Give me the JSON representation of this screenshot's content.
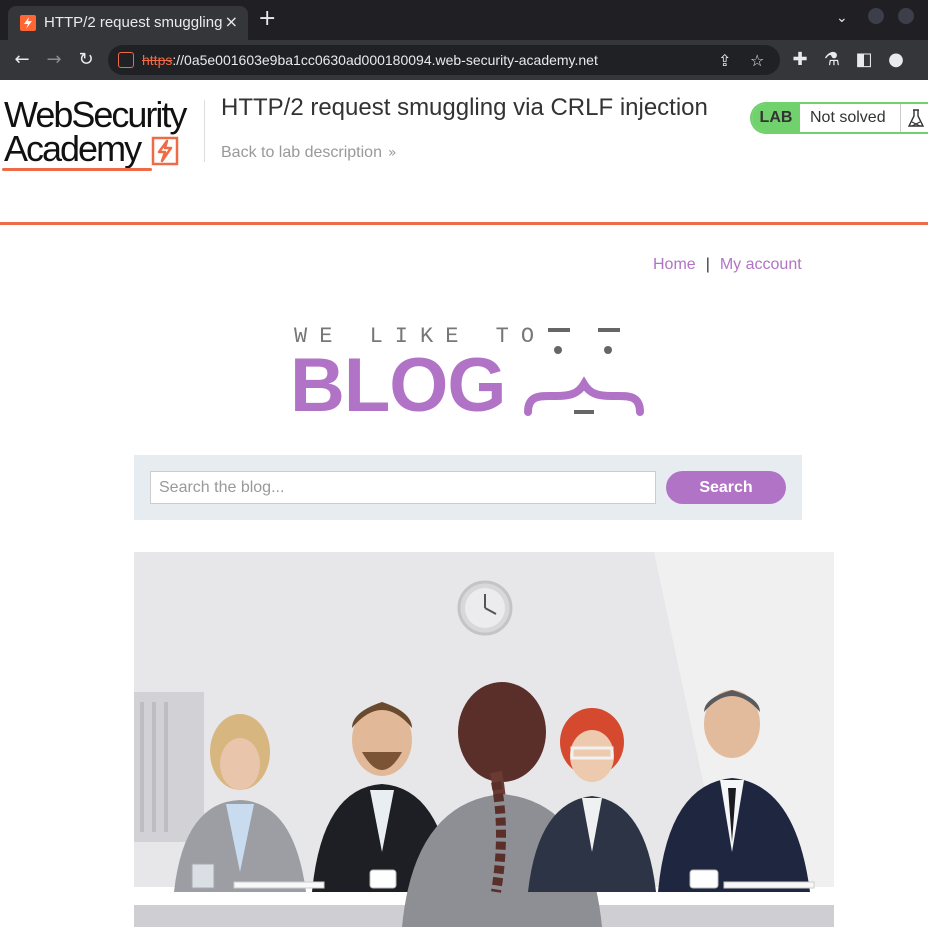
{
  "browser": {
    "tab_title": "HTTP/2 request smuggling",
    "tab_close": "×",
    "new_tab": "+",
    "url_scheme": "https",
    "url_rest": "://0a5e001603e9ba1cc0630ad000180094.web-security-academy.net"
  },
  "academy": {
    "logo_line1": "WebSecurity",
    "logo_line2": "Academy",
    "lab_title": "HTTP/2 request smuggling via CRLF injection",
    "back_link": "Back to lab description",
    "badge_label": "LAB",
    "badge_status": "Not solved"
  },
  "nav": {
    "home": "Home",
    "separator": "|",
    "my_account": "My account"
  },
  "banner": {
    "top_text": "WE LIKE TO",
    "main_text": "BLOG"
  },
  "search": {
    "placeholder": "Search the blog...",
    "button_label": "Search"
  },
  "colors": {
    "accent": "#b173c6",
    "academy_orange": "#ef6a46",
    "lab_green": "#70d16d"
  }
}
